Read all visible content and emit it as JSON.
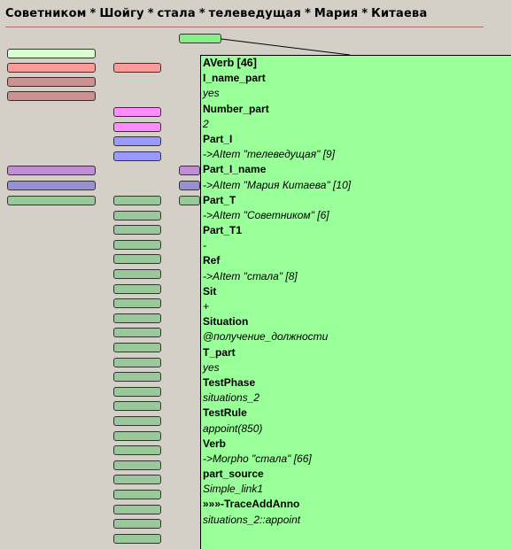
{
  "header": {
    "words": [
      "Советником",
      "Шойгу",
      "стала",
      "телеведущая",
      "Мария",
      "Китаева"
    ],
    "separator": "*"
  },
  "popup": {
    "title": "AVerb [46]",
    "fields": [
      {
        "key": "I_name_part",
        "value": "yes"
      },
      {
        "key": "Number_part",
        "value": "2"
      },
      {
        "key": "Part_I",
        "value": "->AItem \"телеведущая\" [9]"
      },
      {
        "key": "Part_I_name",
        "value": "->AItem \"Мария Китаева\" [10]"
      },
      {
        "key": "Part_T",
        "value": "->AItem \"Советником\" [6]"
      },
      {
        "key": "Part_T1",
        "value": "-"
      },
      {
        "key": "Ref",
        "value": "->AItem \"стала\" [8]"
      },
      {
        "key": "Sit",
        "value": "+"
      },
      {
        "key": "Situation",
        "value": "@получение_должности"
      },
      {
        "key": "T_part",
        "value": "yes"
      },
      {
        "key": "TestPhase",
        "value": "situations_2"
      },
      {
        "key": "TestRule",
        "value": "appoint(850)"
      },
      {
        "key": "Verb",
        "value": "->Morpho \"стала\" [66]"
      },
      {
        "key": "part_source",
        "value": "Simple_link1"
      },
      {
        "key": "»»»-TraceAddAnno",
        "value": "situations_2::appoint"
      }
    ]
  },
  "colors": {
    "background": "#d4d0c8",
    "popup": "#99ff99",
    "underline": "#b36a6a"
  }
}
